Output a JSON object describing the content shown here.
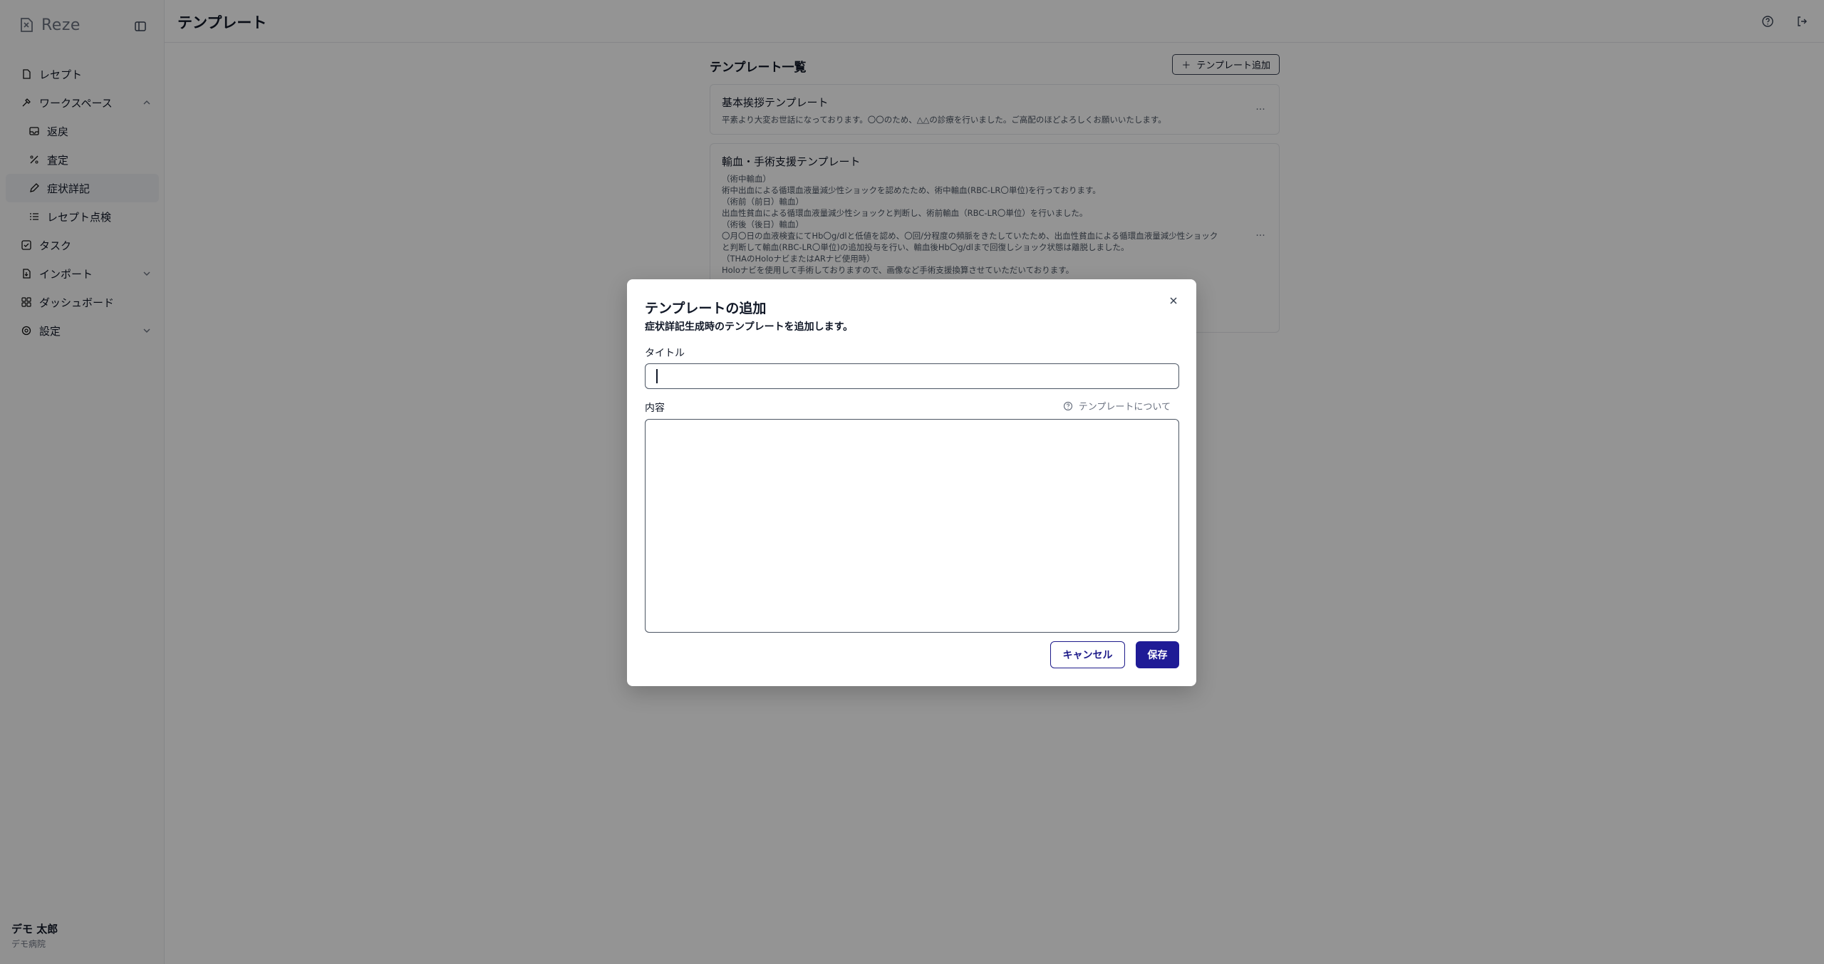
{
  "brand": {
    "name": "Reze"
  },
  "sidebar": {
    "items": [
      {
        "label": "レセプト",
        "icon": "document-icon"
      },
      {
        "label": "ワークスペース",
        "icon": "tools-icon",
        "expanded": true
      },
      {
        "label": "返戻",
        "icon": "inbox-icon"
      },
      {
        "label": "査定",
        "icon": "percent-icon"
      },
      {
        "label": "症状詳記",
        "icon": "pen-icon",
        "active": true
      },
      {
        "label": "レセプト点検",
        "icon": "checklist-icon"
      },
      {
        "label": "タスク",
        "icon": "checkbox-icon"
      },
      {
        "label": "インポート",
        "icon": "import-icon"
      },
      {
        "label": "ダッシュボード",
        "icon": "grid-icon"
      },
      {
        "label": "設定",
        "icon": "gear-icon"
      }
    ],
    "user": {
      "name": "デモ 太郎",
      "org": "デモ病院"
    }
  },
  "header": {
    "title": "テンプレート"
  },
  "main": {
    "list_title": "テンプレート一覧",
    "add_button": "テンプレート追加",
    "templates": [
      {
        "title": "基本挨拶テンプレート",
        "body": "平素より大変お世話になっております。〇〇のため、△△の診療を行いました。ご高配のほどよろしくお願いいたします。"
      },
      {
        "title": "輸血・手術支援テンプレート",
        "body": "（術中輸血）\n術中出血による循環血液量減少性ショックを認めたため、術中輸血(RBC-LR〇単位)を行っております。\n（術前（前日）輸血）\n出血性貧血による循環血液量減少性ショックと判断し、術前輸血（RBC-LR〇単位）を行いました。\n（術後（後日）輸血）\n〇月〇日の血液検査にてHb〇g/dlと低値を認め、〇回/分程度の頻脈をきたしていたため、出血性貧血による循環血液量減少性ショック\nと判断して輸血(RBC-LR〇単位)の追加投与を行い、輸血後Hb〇g/dlまで回復しショック状態は離脱しました。\n（THAのHoloナビまたはARナビ使用時）\nHoloナビを使用して手術しておりますので、画像など手術支援換算させていただいております。"
      }
    ]
  },
  "dialog": {
    "title": "テンプレートの追加",
    "description": "症状詳記生成時のテンプレートを追加します。",
    "title_label": "タイトル",
    "title_value": "",
    "content_label": "内容",
    "content_value": "",
    "about_link": "テンプレートについて",
    "cancel": "キャンセル",
    "save": "保存"
  },
  "colors": {
    "primary": "#1f1b96",
    "overlay": "rgba(0,0,0,0.42)"
  }
}
